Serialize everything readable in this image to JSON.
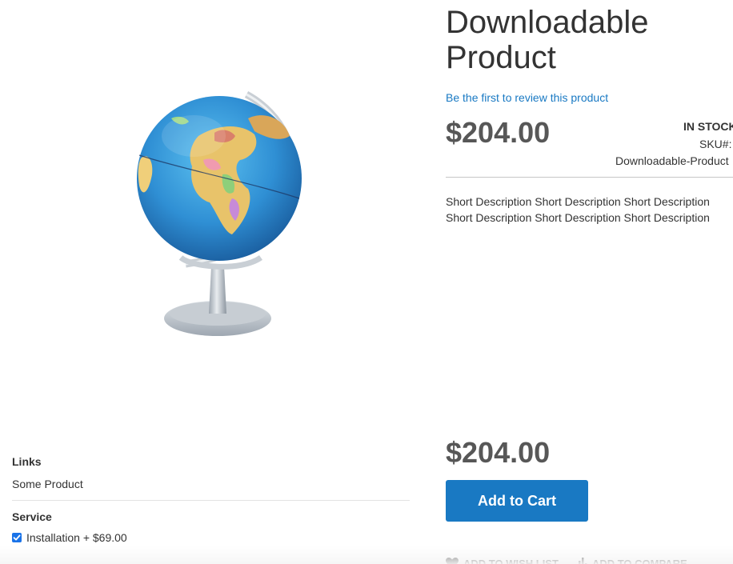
{
  "product": {
    "title": "Downloadable Product",
    "review_link": "Be the first to review this product",
    "price": "$204.00",
    "stock_status": "IN STOCK",
    "sku_label": "SKU#:",
    "sku_value": "Downloadable-Product",
    "short_description": "Short Description Short Description Short Description Short Description Short Description Short Description",
    "image_icon": "globe-product-image"
  },
  "options": {
    "links_heading": "Links",
    "links_item": "Some Product",
    "service_heading": "Service",
    "service_item_label": "Installation + $69.00",
    "service_item_checked": true
  },
  "cart": {
    "price": "$204.00",
    "add_to_cart_label": "Add to Cart"
  },
  "actions": {
    "wishlist_label": "ADD TO WISH LIST",
    "wishlist_icon": "heart-icon",
    "compare_label": "ADD TO COMPARE",
    "compare_icon": "compare-bars-icon"
  },
  "colors": {
    "accent": "#1979c3",
    "price": "#575757",
    "text": "#333333"
  }
}
